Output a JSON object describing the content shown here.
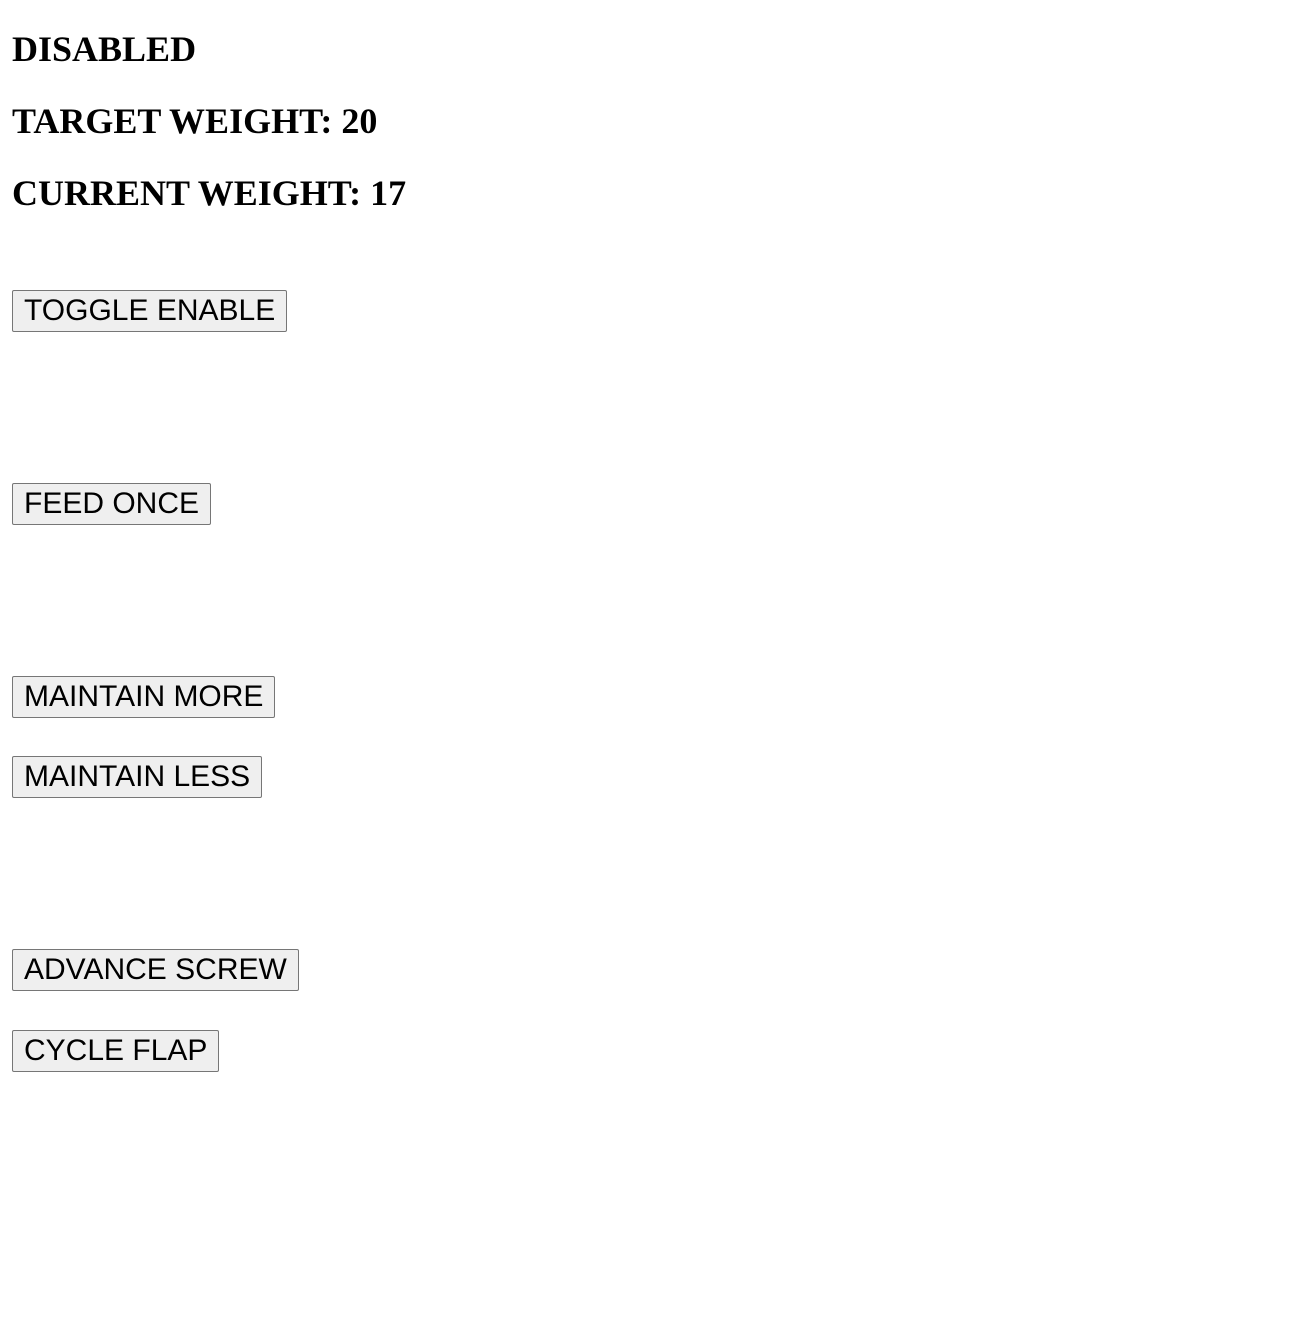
{
  "status": {
    "state": "DISABLED",
    "target_label": "TARGET WEIGHT:",
    "target_value": "20",
    "current_label": "CURRENT WEIGHT:",
    "current_value": "17"
  },
  "controls": {
    "toggle_enable": "TOGGLE ENABLE",
    "feed_once": "FEED ONCE",
    "maintain_more": "MAINTAIN MORE",
    "maintain_less": "MAINTAIN LESS",
    "advance_screw": "ADVANCE SCREW",
    "cycle_flap": "CYCLE FLAP"
  }
}
